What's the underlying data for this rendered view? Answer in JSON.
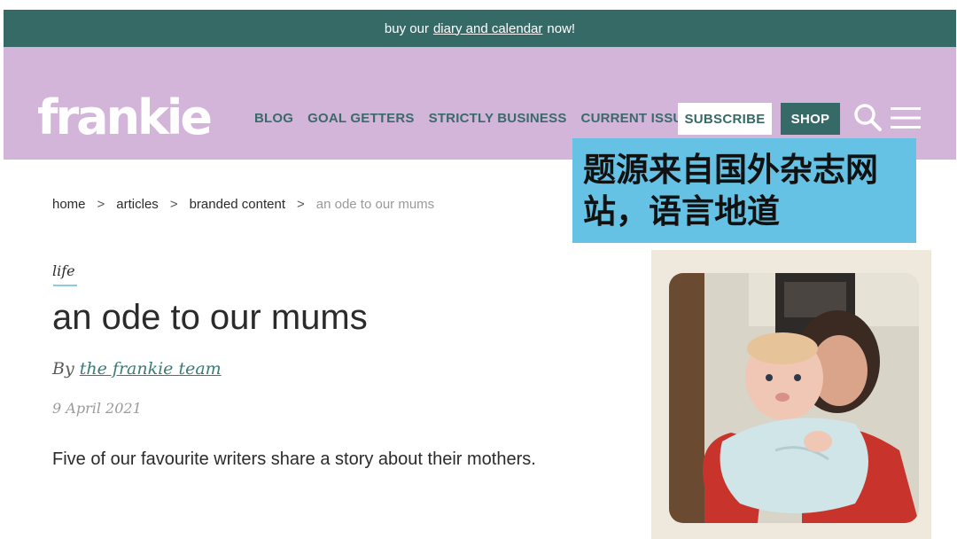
{
  "promo": {
    "prefix": "buy our",
    "link": "diary and calendar",
    "suffix": "now!"
  },
  "header": {
    "logo": "frankie",
    "nav": [
      "BLOG",
      "GOAL GETTERS",
      "STRICTLY BUSINESS",
      "CURRENT ISSUE"
    ],
    "subscribe": "SUBSCRIBE",
    "shop": "SHOP",
    "icons": {
      "search": "search-icon",
      "menu": "hamburger-menu-icon"
    }
  },
  "overlay": {
    "line1": "题源来自国外杂志网",
    "line2": "站，语言地道"
  },
  "breadcrumb": {
    "items": [
      "home",
      "articles",
      "branded content",
      "an ode to our mums"
    ],
    "separator": ">"
  },
  "article": {
    "tag": "life",
    "title": "an ode to our mums",
    "by_prefix": "By",
    "author": "the frankie team",
    "date": "9 April 2021",
    "standfirst": "Five of our favourite writers share a story about their mothers."
  },
  "colors": {
    "promo_bg": "#366a66",
    "header_bg": "#d3b5d9",
    "nav_text": "#3a6a6c",
    "overlay_bg": "#65c2e4",
    "author_link": "#3a7b76"
  }
}
